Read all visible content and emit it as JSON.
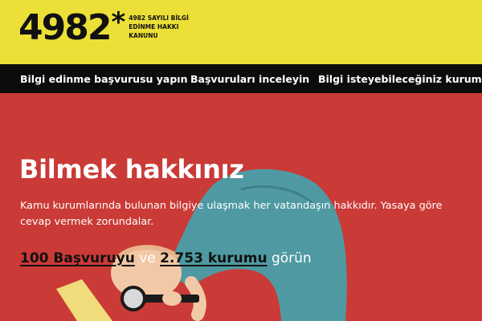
{
  "logo": {
    "number": "4982",
    "star": "*",
    "subtitle": "4982 SAYILI BİLGİ EDİNME HAKKI KANUNU"
  },
  "nav": {
    "items": [
      {
        "label": "Bilgi edinme başvurusu yapın"
      },
      {
        "label": "Başvuruları inceleyin"
      },
      {
        "label": "Bilgi isteyebileceğiniz kurumlar"
      }
    ]
  },
  "hero": {
    "title": "Bilmek hakkınız",
    "description": "Kamu kurumlarında bulunan bilgiye ulaşmak her vatandaşın hakkıdır. Yasaya göre cevap vermek zorundalar.",
    "stats": {
      "requests_link": "100 Başvuruyu",
      "connector": " ve ",
      "agencies_link": "2.753 kurumu",
      "suffix": " görün"
    }
  },
  "colors": {
    "header_bg": "#ecdf37",
    "nav_bg": "#0c0c0c",
    "hero_bg": "#ca3a36",
    "figure_shirt": "#4f9aa2",
    "figure_skin": "#f2c9a6"
  },
  "icons": {
    "illustration": "person-with-magnifying-glass"
  }
}
